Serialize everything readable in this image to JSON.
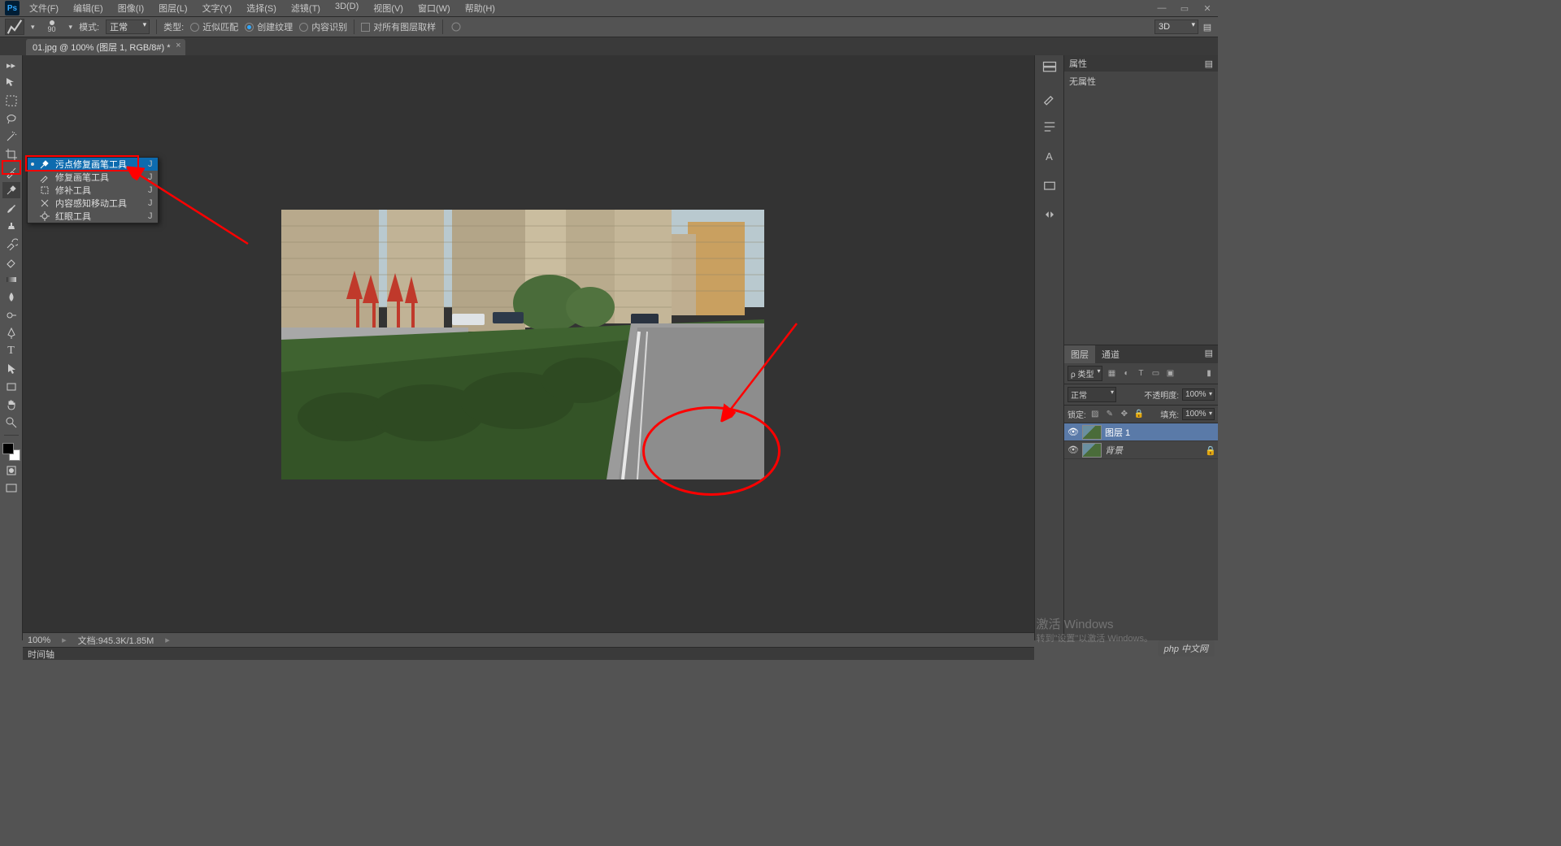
{
  "app": {
    "logo": "Ps"
  },
  "menu": {
    "file": "文件(F)",
    "edit": "编辑(E)",
    "image": "图像(I)",
    "layer": "图层(L)",
    "type": "文字(Y)",
    "select": "选择(S)",
    "filter": "滤镜(T)",
    "threeD": "3D(D)",
    "view": "视图(V)",
    "window": "窗口(W)",
    "help": "帮助(H)"
  },
  "options": {
    "brushSize": "90",
    "modeLabel": "模式:",
    "modeValue": "正常",
    "typeLabel": "类型:",
    "radio1": "近似匹配",
    "radio2": "创建纹理",
    "radio3": "内容识别",
    "check1": "对所有图层取样",
    "threeDLabel": "3D"
  },
  "documentTab": "01.jpg @ 100% (图层 1, RGB/8#) *",
  "flyout": {
    "items": [
      {
        "label": "污点修复画笔工具",
        "key": "J",
        "selected": true
      },
      {
        "label": "修复画笔工具",
        "key": "J",
        "selected": false
      },
      {
        "label": "修补工具",
        "key": "J",
        "selected": false
      },
      {
        "label": "内容感知移动工具",
        "key": "J",
        "selected": false
      },
      {
        "label": "红眼工具",
        "key": "J",
        "selected": false
      }
    ]
  },
  "properties": {
    "tab": "属性",
    "noProps": "无属性"
  },
  "layers": {
    "tabLayers": "图层",
    "tabChannels": "通道",
    "filterKind": "ρ 类型",
    "blendMode": "正常",
    "opacityLabel": "不透明度:",
    "opacityValue": "100%",
    "lockLabel": "锁定:",
    "fillLabel": "填充:",
    "fillValue": "100%",
    "rows": [
      {
        "name": "图层 1",
        "selected": true,
        "locked": false
      },
      {
        "name": "背景",
        "selected": false,
        "locked": true
      }
    ]
  },
  "status": {
    "zoom": "100%",
    "docLabel": "文档:",
    "docSize": "945.3K/1.85M"
  },
  "timeline": {
    "label": "时间轴"
  },
  "watermark": {
    "title": "激活 Windows",
    "sub": "转到\"设置\"以激活 Windows。"
  },
  "phpMark": "php 中文网"
}
